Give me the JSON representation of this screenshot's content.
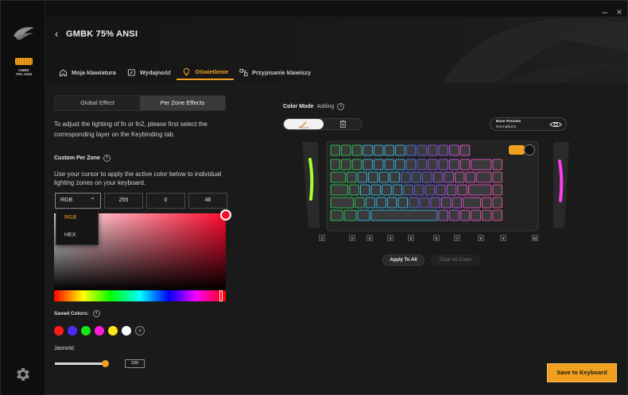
{
  "window": {
    "minimize_glyph": "–",
    "close_glyph": "×"
  },
  "rail": {
    "logo_icon": "brand-swoosh-icon",
    "device_label_line1": "GMBK",
    "device_label_line2": "75% ANSI",
    "settings_icon": "gear-icon"
  },
  "header": {
    "back_glyph": "‹",
    "title": "GMBK 75% ANSI",
    "tabs": [
      {
        "label": "Moja klawiatura",
        "icon": "home-icon",
        "active": false
      },
      {
        "label": "Wydajność",
        "icon": "speedometer-icon",
        "active": false
      },
      {
        "label": "Oświetlenie",
        "icon": "bulb-icon",
        "active": true
      },
      {
        "label": "Przypisanie klawiszy",
        "icon": "keymap-icon",
        "active": false
      }
    ]
  },
  "left_panel": {
    "segments": [
      {
        "label": "Global Effect",
        "active": false
      },
      {
        "label": "Per Zone Effects",
        "active": true
      }
    ],
    "instruction": "To adjust the lighting of fn or fn2, please first select the corresponding layer on the Keybinding tab.",
    "custom_per_zone_label": "Custom Per Zone",
    "cursor_instruction": "Use your cursor to apply the active color below to individual lighting zones on your keyboard.",
    "color_mode": {
      "selected": "RGB",
      "options": [
        "RGB",
        "HEX"
      ],
      "values": [
        "255",
        "0",
        "46"
      ]
    },
    "active_color": "#ff002e",
    "saved_colors_label": "Saved Colors:",
    "saved_colors": [
      "#ff1a1a",
      "#4d2cff",
      "#19e619",
      "#ff1ad9",
      "#ffe61a",
      "#ffffff"
    ],
    "brightness_label": "Jasność",
    "brightness_value": "100",
    "brightness_fraction": 1.0
  },
  "right_panel": {
    "color_mode_label": "Color Mode",
    "color_mode_state": "Adding",
    "base_preview_title": "Base Preview",
    "base_preview_value": "NormallyOn",
    "zones": [
      "1",
      "2",
      "3",
      "4",
      "5",
      "6",
      "7",
      "8",
      "9",
      "10"
    ],
    "apply_all_label": "Apply To All",
    "clear_all_label": "Clear All Zones"
  },
  "footer": {
    "save_label": "Save to Keyboard"
  },
  "colors": {
    "accent": "#f0a01e",
    "background": "#1a1a1b"
  }
}
